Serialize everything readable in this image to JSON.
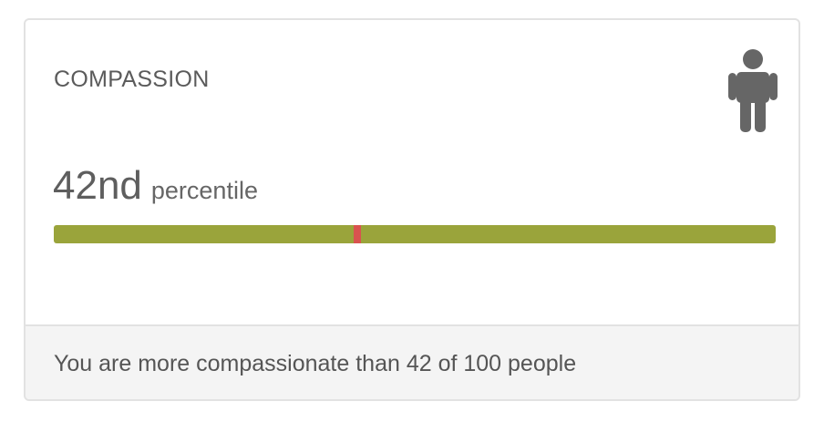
{
  "card": {
    "title": "COMPASSION",
    "icon": "person-icon",
    "score": {
      "value": "42nd",
      "unit": "percentile",
      "percentile": 42
    },
    "bar": {
      "bar_color": "#9aa43b",
      "marker_color": "#d9534f"
    },
    "footer": {
      "text": "You are more compassionate than 42 of 100 people"
    }
  }
}
